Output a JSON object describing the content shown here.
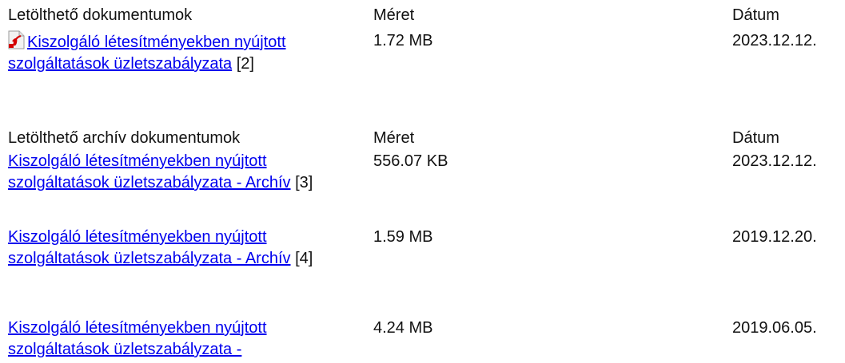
{
  "sections": [
    {
      "header": {
        "name": "Letölthető dokumentumok",
        "size": "Méret",
        "date": "Dátum"
      },
      "items": [
        {
          "title": "Kiszolgáló létesítményekben nyújtott szolgáltatások üzletszabályzata",
          "ref": "[2]",
          "size": "1.72 MB",
          "date": "2023.12.12.",
          "icon": "pdf-icon"
        }
      ]
    },
    {
      "header": {
        "name": "Letölthető archív dokumentumok",
        "size": "Méret",
        "date": "Dátum"
      },
      "items": [
        {
          "title": "Kiszolgáló létesítményekben nyújtott szolgáltatások üzletszabályzata - Archív",
          "ref": "[3]",
          "size": "556.07 KB",
          "date": "2023.12.12."
        },
        {
          "title": "Kiszolgáló létesítményekben nyújtott szolgáltatások üzletszabályzata - Archív",
          "ref": "[4]",
          "size": "1.59 MB",
          "date": "2019.12.20."
        },
        {
          "title": "Kiszolgáló létesítményekben nyújtott szolgáltatások üzletszabályzata -",
          "ref": "",
          "size": "4.24 MB",
          "date": "2019.06.05."
        }
      ]
    }
  ]
}
